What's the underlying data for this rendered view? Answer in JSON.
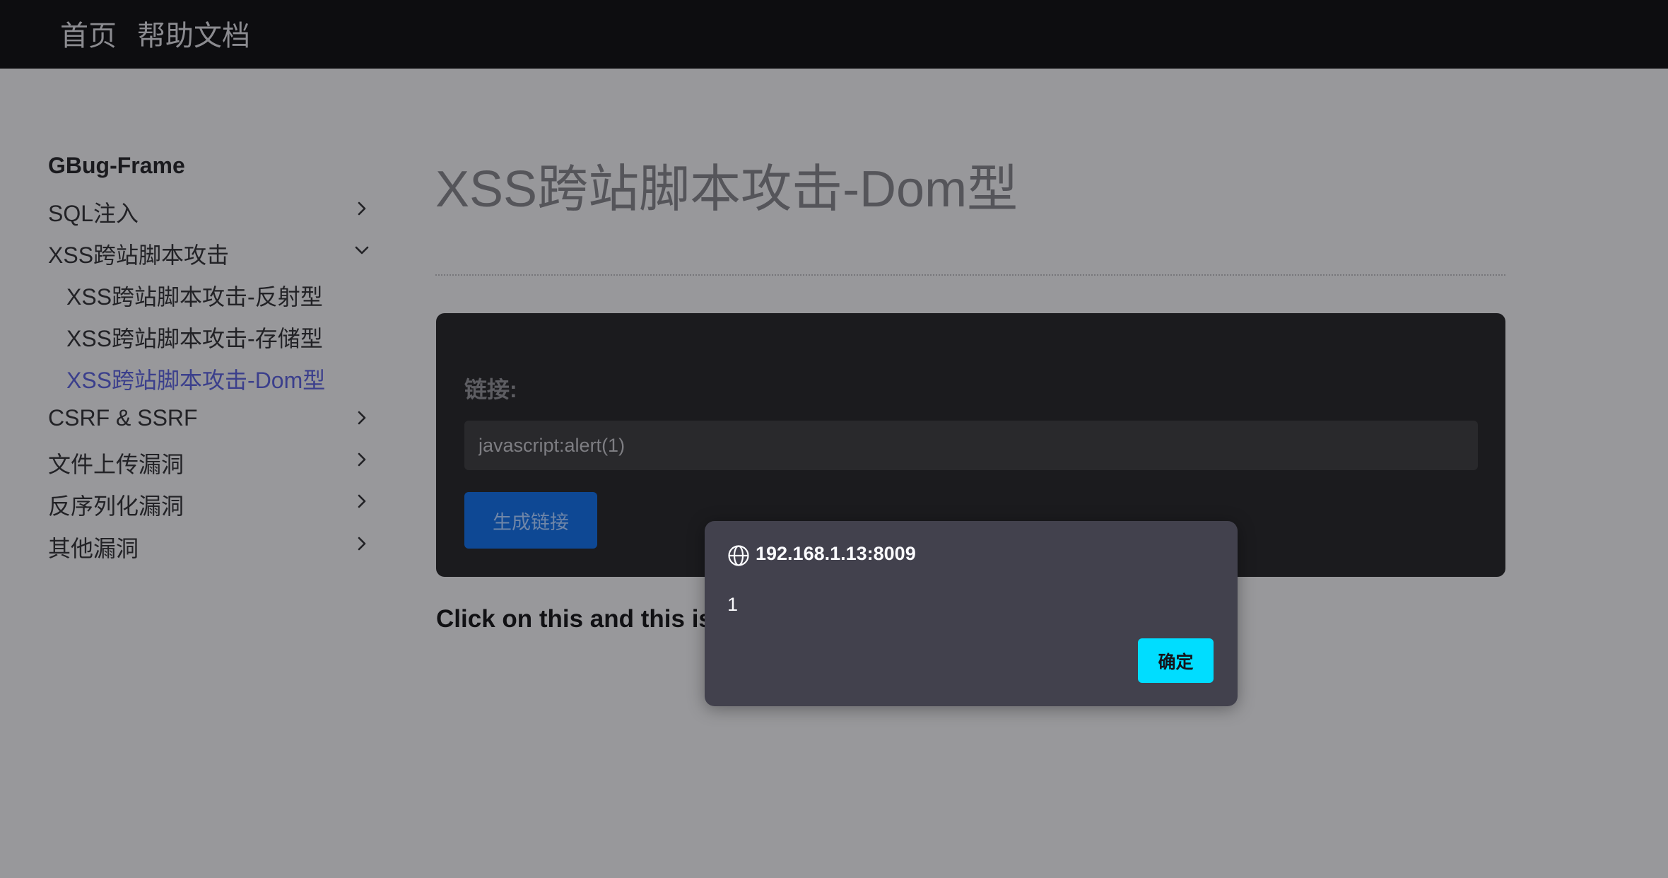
{
  "topnav": {
    "items": [
      {
        "label": "首页"
      },
      {
        "label": "帮助文档"
      }
    ]
  },
  "sidebar": {
    "brand": "GBug-Frame",
    "items": [
      {
        "label": "SQL注入",
        "icon": "chevron-right-icon"
      },
      {
        "label": "XSS跨站脚本攻击",
        "icon": "chevron-down-icon",
        "expanded": true,
        "children": [
          {
            "label": "XSS跨站脚本攻击-反射型"
          },
          {
            "label": "XSS跨站脚本攻击-存储型"
          },
          {
            "label": "XSS跨站脚本攻击-Dom型",
            "active": true
          }
        ]
      },
      {
        "label": "CSRF & SSRF",
        "icon": "chevron-right-icon"
      },
      {
        "label": "文件上传漏洞",
        "icon": "chevron-right-icon"
      },
      {
        "label": "反序列化漏洞",
        "icon": "chevron-right-icon"
      },
      {
        "label": "其他漏洞",
        "icon": "chevron-right-icon"
      }
    ]
  },
  "main": {
    "title": "XSS跨站脚本攻击-Dom型",
    "form": {
      "label": "链接:",
      "input_value": "javascript:alert(1)",
      "button_label": "生成链接"
    },
    "result_text": "Click on this and this is"
  },
  "dialog": {
    "origin": "192.168.1.13:8009",
    "message": "1",
    "ok_label": "确定"
  },
  "colors": {
    "accent_active": "#3b3f8c",
    "button_primary": "#0e4894",
    "dialog_ok": "#00ddff"
  }
}
